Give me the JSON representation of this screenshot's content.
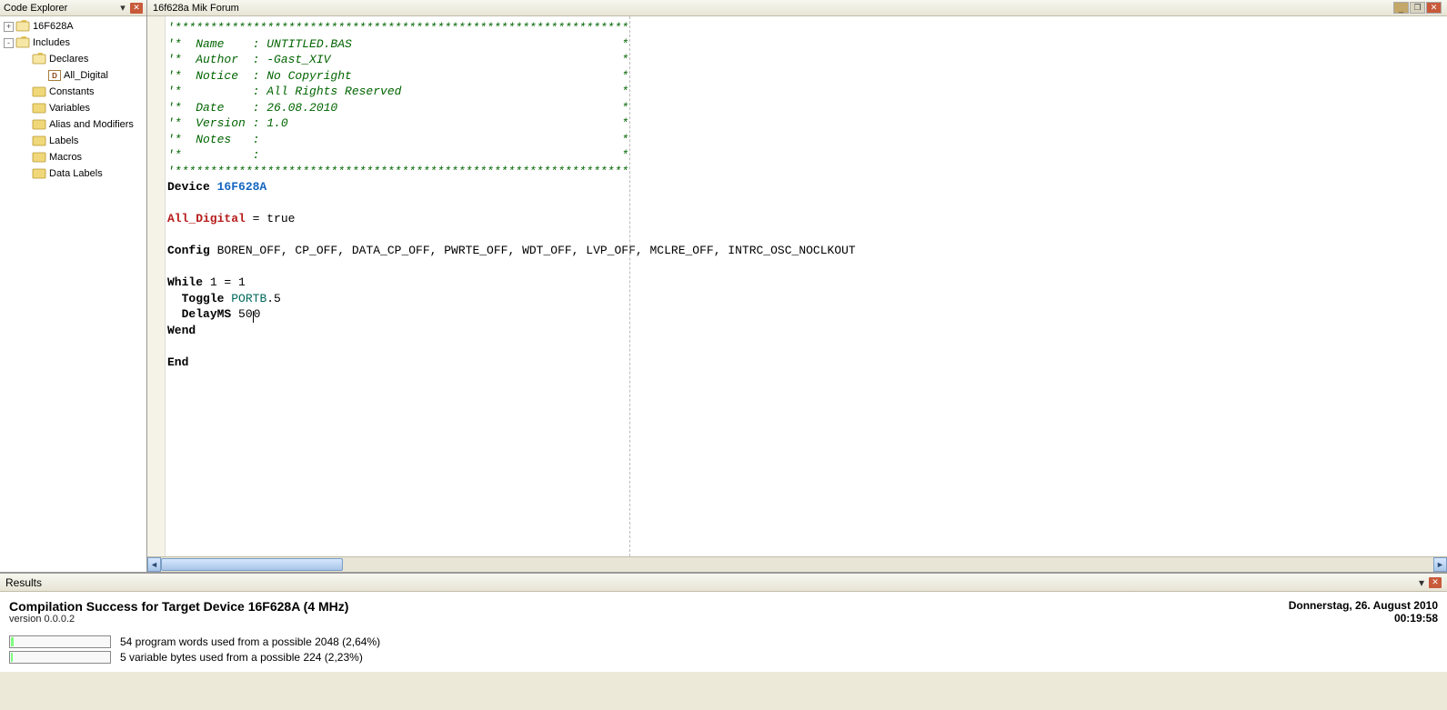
{
  "sidebar": {
    "title": "Code Explorer",
    "items": [
      {
        "label": "16F628A",
        "icon": "folder-open",
        "expander": "+",
        "indent": 0
      },
      {
        "label": "Includes",
        "icon": "folder-open",
        "expander": "-",
        "indent": 0
      },
      {
        "label": "Declares",
        "icon": "folder-open",
        "expander": "",
        "indent": 1
      },
      {
        "label": "All_Digital",
        "icon": "def",
        "expander": "",
        "indent": 2
      },
      {
        "label": "Constants",
        "icon": "folder",
        "expander": "",
        "indent": 1
      },
      {
        "label": "Variables",
        "icon": "folder",
        "expander": "",
        "indent": 1
      },
      {
        "label": "Alias and Modifiers",
        "icon": "folder",
        "expander": "",
        "indent": 1
      },
      {
        "label": "Labels",
        "icon": "folder",
        "expander": "",
        "indent": 1
      },
      {
        "label": "Macros",
        "icon": "folder",
        "expander": "",
        "indent": 1
      },
      {
        "label": "Data Labels",
        "icon": "folder",
        "expander": "",
        "indent": 1
      }
    ]
  },
  "editor": {
    "title": "16f628a Mik Forum",
    "code": {
      "header_stars_top": "'****************************************************************",
      "h_name": "'*  Name    : UNTITLED.BAS                                      *",
      "h_author": "'*  Author  : -Gast_XIV                                         *",
      "h_notice": "'*  Notice  : No Copyright                                      *",
      "h_rights": "'*          : All Rights Reserved                               *",
      "h_date": "'*  Date    : 26.08.2010                                        *",
      "h_version": "'*  Version : 1.0                                               *",
      "h_notes": "'*  Notes   :                                                   *",
      "h_blank": "'*          :                                                   *",
      "header_stars_bot": "'****************************************************************",
      "kw_device": "Device",
      "device_name": "16F628A",
      "def_alldigital": "All_Digital",
      "eq_true": " = true",
      "kw_config": "Config",
      "config_vals": " BOREN_OFF, CP_OFF, DATA_CP_OFF, PWRTE_OFF, WDT_OFF, LVP_OFF, MCLRE_OFF, INTRC_OSC_NOCLKOUT",
      "kw_while": "While",
      "while_cond": " 1 = 1",
      "kw_toggle": "Toggle",
      "port": "PORTB",
      "port_bit": ".5",
      "kw_delay": "DelayMS",
      "delay_pre": " 50",
      "delay_post": "0",
      "kw_wend": "Wend",
      "kw_end": "End"
    }
  },
  "results": {
    "title": "Results",
    "success": "Compilation Success for Target Device 16F628A (4 MHz)",
    "version": "version 0.0.0.2",
    "date": "Donnerstag, 26. August 2010",
    "time": "00:19:58",
    "stat1": "54 program words used from a possible 2048 (2,64%)",
    "stat2": "5 variable bytes used from a possible 224 (2,23%)",
    "pct1": 2.64,
    "pct2": 2.23
  }
}
